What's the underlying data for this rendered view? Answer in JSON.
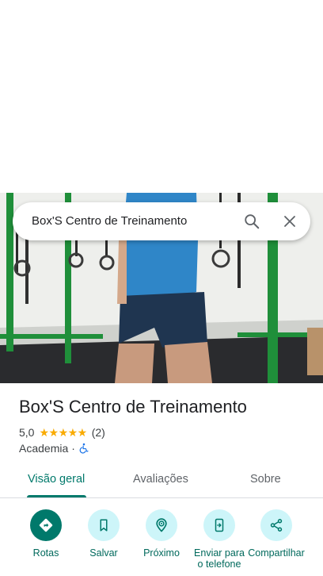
{
  "search": {
    "query": "Box'S Centro de Treinamento"
  },
  "place": {
    "name": "Box'S Centro de Treinamento",
    "rating": "5,0",
    "stars": "★★★★★",
    "review_count": "(2)",
    "category": "Academia",
    "separator": "·"
  },
  "tabs": [
    {
      "label": "Visão geral",
      "active": true
    },
    {
      "label": "Avaliações",
      "active": false
    },
    {
      "label": "Sobre",
      "active": false
    }
  ],
  "actions": [
    {
      "label": "Rotas",
      "icon": "directions-icon"
    },
    {
      "label": "Salvar",
      "icon": "bookmark-icon"
    },
    {
      "label": "Próximo",
      "icon": "nearby-icon"
    },
    {
      "label": "Enviar para o telefone",
      "icon": "send-to-phone-icon"
    },
    {
      "label": "Compartilhar",
      "icon": "share-icon"
    }
  ],
  "colors": {
    "accent": "#00796b",
    "action_bg": "#cdf5f9",
    "star": "#f9ab00",
    "accessibility": "#1a73e8"
  }
}
